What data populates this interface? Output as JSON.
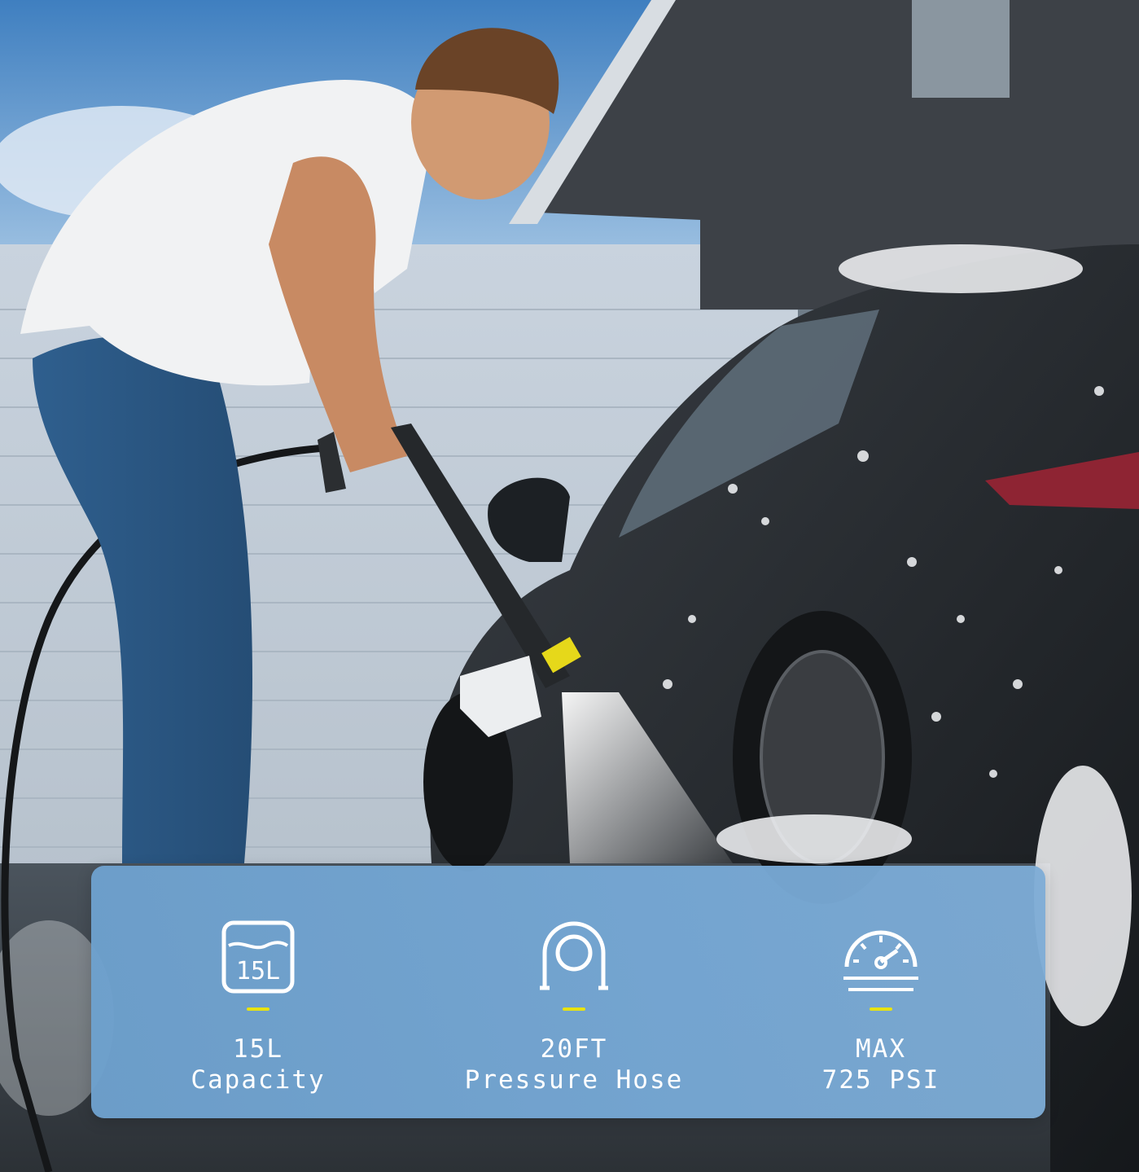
{
  "colors": {
    "accent": "#e9e30f",
    "panel": "#76a8d5",
    "text": "#ffffff"
  },
  "features": [
    {
      "icon": "tank-15l-icon",
      "icon_text": "15L",
      "line1": "15L",
      "line2": "Capacity"
    },
    {
      "icon": "hose-reel-icon",
      "line1": "20FT",
      "line2": "Pressure Hose"
    },
    {
      "icon": "pressure-gauge-icon",
      "line1": "MAX",
      "line2": "725 PSI"
    }
  ]
}
